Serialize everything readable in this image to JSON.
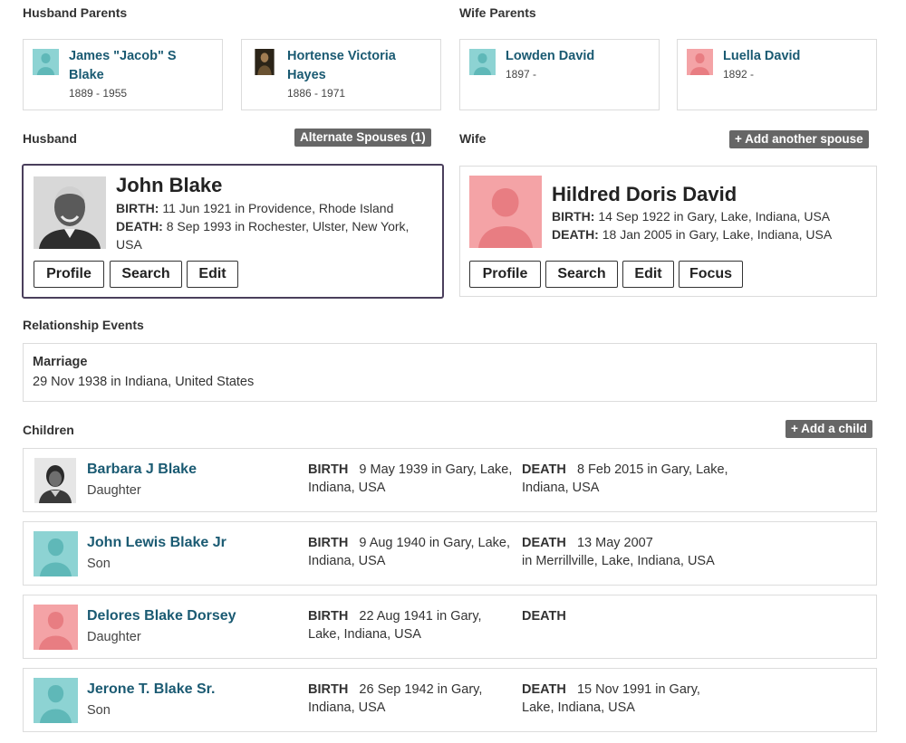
{
  "husband_parents": {
    "label": "Husband Parents",
    "father": {
      "name": "James \"Jacob\" S Blake",
      "dates": "1889 - 1955",
      "avatar": "male-silhouette-icon"
    },
    "mother": {
      "name": "Hortense Victoria Hayes",
      "dates": "1886 - 1971",
      "avatar": "photo"
    }
  },
  "wife_parents": {
    "label": "Wife Parents",
    "father": {
      "name": "Lowden David",
      "dates": "1897 -",
      "avatar": "male-silhouette-icon"
    },
    "mother": {
      "name": "Luella David",
      "dates": "1892 -",
      "avatar": "female-silhouette-icon"
    }
  },
  "husband": {
    "label": "Husband",
    "alt_spouses_label": "Alternate Spouses (1)",
    "name": "John Blake",
    "birth_label": "BIRTH:",
    "birth": "11 Jun 1921 in Providence, Rhode Island",
    "death_label": "DEATH:",
    "death": "8 Sep 1993 in Rochester, Ulster, New York, USA",
    "buttons": {
      "profile": "Profile",
      "search": "Search",
      "edit": "Edit"
    }
  },
  "wife": {
    "label": "Wife",
    "add_spouse_label": "+ Add another spouse",
    "name": "Hildred Doris David",
    "birth_label": "BIRTH:",
    "birth": "14 Sep 1922 in Gary, Lake, Indiana, USA",
    "death_label": "DEATH:",
    "death": "18 Jan 2005 in Gary, Lake, Indiana, USA",
    "buttons": {
      "profile": "Profile",
      "search": "Search",
      "edit": "Edit",
      "focus": "Focus"
    }
  },
  "relationship_events": {
    "label": "Relationship Events",
    "event_title": "Marriage",
    "event_detail": "29 Nov 1938 in Indiana, United States"
  },
  "children": {
    "label": "Children",
    "add_child_label": "+ Add a child",
    "birth_label": "BIRTH",
    "death_label": "DEATH",
    "items": [
      {
        "name": "Barbara J Blake",
        "relation": "Daughter",
        "birth_l1": "9 May 1939  in Gary, Lake,",
        "birth_l2": "Indiana, USA",
        "death_l1": "8 Feb 2015  in Gary, Lake,",
        "death_l2": "Indiana, USA"
      },
      {
        "name": "John Lewis Blake Jr",
        "relation": "Son",
        "birth_l1": "9 Aug 1940  in Gary, Lake,",
        "birth_l2": "Indiana, USA",
        "death_l1": "13 May 2007",
        "death_l2": " in Merrillville, Lake, Indiana, USA"
      },
      {
        "name": "Delores Blake Dorsey",
        "relation": "Daughter",
        "birth_l1": "22 Aug 1941  in Gary,",
        "birth_l2": "Lake, Indiana, USA",
        "death_l1": "",
        "death_l2": ""
      },
      {
        "name": "Jerone T. Blake Sr.",
        "relation": "Son",
        "birth_l1": "26 Sep 1942  in Gary,",
        "birth_l2": "Indiana, USA",
        "death_l1": "15 Nov 1991  in Gary,",
        "death_l2": "Lake, Indiana, USA"
      }
    ]
  },
  "colors": {
    "link": "#1a5a72",
    "male_avatar_bg": "#8dd3d3",
    "female_avatar_bg": "#f4a3a6",
    "pill_bg": "#666666",
    "selected_border": "#4a3f5c"
  }
}
